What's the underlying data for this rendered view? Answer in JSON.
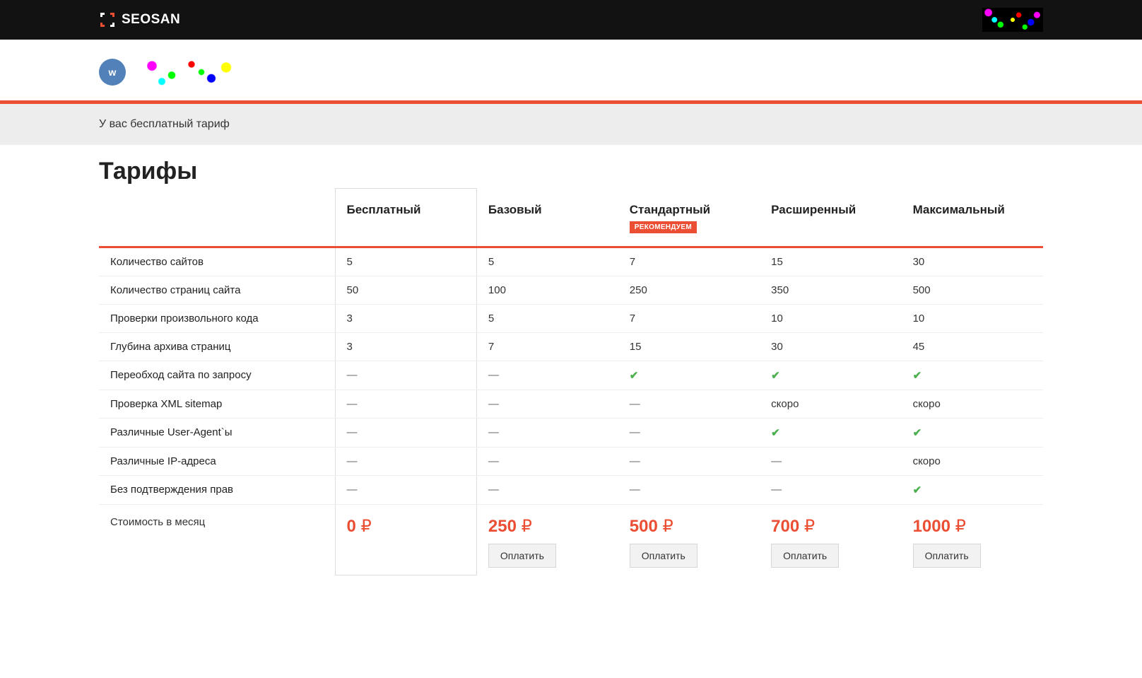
{
  "header": {
    "logo_text": "SEOSAN"
  },
  "user": {
    "vk_label": "w"
  },
  "notice": "У вас бесплатный тариф",
  "page_title": "Тарифы",
  "badge_recommend": "РЕКОМЕНДУЕМ",
  "pay_label": "Оплатить",
  "dash": "—",
  "check": "✔",
  "plans": [
    {
      "name": "Бесплатный",
      "recommended": false,
      "price": "0",
      "payable": false,
      "current": true
    },
    {
      "name": "Базовый",
      "recommended": false,
      "price": "250",
      "payable": true,
      "current": false
    },
    {
      "name": "Стандартный",
      "recommended": true,
      "price": "500",
      "payable": true,
      "current": false
    },
    {
      "name": "Расширенный",
      "recommended": false,
      "price": "700",
      "payable": true,
      "current": false
    },
    {
      "name": "Максимальный",
      "recommended": false,
      "price": "1000",
      "payable": true,
      "current": false
    }
  ],
  "features": [
    {
      "label": "Количество сайтов",
      "values": [
        "5",
        "5",
        "7",
        "15",
        "30"
      ]
    },
    {
      "label": "Количество страниц сайта",
      "values": [
        "50",
        "100",
        "250",
        "350",
        "500"
      ]
    },
    {
      "label": "Проверки произвольного кода",
      "values": [
        "3",
        "5",
        "7",
        "10",
        "10"
      ]
    },
    {
      "label": "Глубина архива страниц",
      "values": [
        "3",
        "7",
        "15",
        "30",
        "45"
      ]
    },
    {
      "label": "Переобход сайта по запросу",
      "values": [
        "—",
        "—",
        "✔",
        "✔",
        "✔"
      ]
    },
    {
      "label": "Проверка XML sitemap",
      "values": [
        "—",
        "—",
        "—",
        "скоро",
        "скоро"
      ]
    },
    {
      "label": "Различные User-Agent`ы",
      "values": [
        "—",
        "—",
        "—",
        "✔",
        "✔"
      ]
    },
    {
      "label": "Различные IP-адреса",
      "values": [
        "—",
        "—",
        "—",
        "—",
        "скоро"
      ]
    },
    {
      "label": "Без подтверждения прав",
      "values": [
        "—",
        "—",
        "—",
        "—",
        "✔"
      ]
    }
  ],
  "price_row_label": "Стоимость в месяц",
  "currency_symbol": "₽"
}
